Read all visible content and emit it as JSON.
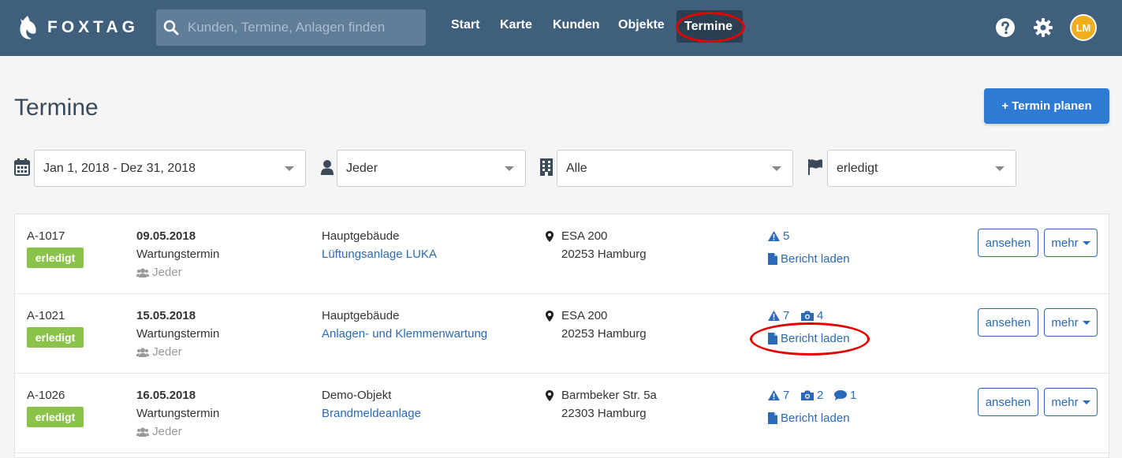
{
  "app": {
    "logo_text": "FOXTAG"
  },
  "search": {
    "placeholder": "Kunden, Termine, Anlagen finden"
  },
  "nav": {
    "items": [
      "Start",
      "Karte",
      "Kunden",
      "Objekte"
    ],
    "active": "Termine"
  },
  "user": {
    "initials": "LM"
  },
  "page": {
    "title": "Termine",
    "primary_button": "+ Termin planen"
  },
  "filters": {
    "date_range": "Jan 1, 2018 - Dez 31, 2018",
    "user": "Jeder",
    "building": "Alle",
    "status": "erledigt"
  },
  "appointments": [
    {
      "id": "A-1017",
      "status": "erledigt",
      "date": "09.05.2018",
      "type": "Wartungstermin",
      "assignee": "Jeder",
      "building": "Hauptgebäude",
      "system": "Lüftungsanlage LUKA",
      "street": "ESA 200",
      "city": "20253 Hamburg",
      "warnings": "5",
      "report": "Bericht laden",
      "view": "ansehen",
      "more": "mehr"
    },
    {
      "id": "A-1021",
      "status": "erledigt",
      "date": "15.05.2018",
      "type": "Wartungstermin",
      "assignee": "Jeder",
      "building": "Hauptgebäude",
      "system": "Anlagen- und Klemmenwartung",
      "street": "ESA 200",
      "city": "20253 Hamburg",
      "warnings": "7",
      "photos": "4",
      "report": "Bericht laden",
      "view": "ansehen",
      "more": "mehr"
    },
    {
      "id": "A-1026",
      "status": "erledigt",
      "date": "16.05.2018",
      "type": "Wartungstermin",
      "assignee": "Jeder",
      "building": "Demo-Objekt",
      "system": "Brandmeldeanlage",
      "street": "Barmbeker Str. 5a",
      "city": "22303 Hamburg",
      "warnings": "7",
      "photos": "2",
      "comments": "1",
      "report": "Bericht laden",
      "view": "ansehen",
      "more": "mehr"
    }
  ],
  "colors": {
    "navbar": "#3f5f7d",
    "primary": "#2e7bd6",
    "success": "#8bc34a",
    "link": "#2a6ab8",
    "annotation": "#e60000"
  }
}
